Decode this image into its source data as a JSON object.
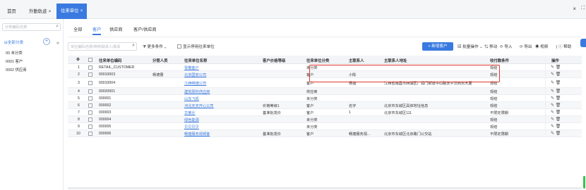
{
  "tabs": [
    {
      "label": "首页",
      "closable": false
    },
    {
      "label": "外勤轨迹",
      "closable": true
    },
    {
      "label": "往来单位",
      "closable": true
    }
  ],
  "left_panel": {
    "search_placeholder": "分类编码/名称",
    "all_label": "全部分类",
    "items": [
      "00 未分类",
      "0001 客户",
      "0002 供应商"
    ]
  },
  "subtabs": [
    "全部",
    "客户",
    "供应商",
    "客户/供应商"
  ],
  "active_subtab": 1,
  "toolbar": {
    "search_placeholder": "单位编码/名称/简称/联系人/联系",
    "more_conditions": "更多条件",
    "show_disabled": "显示停用往来单位",
    "new_button": "+ 新增客户",
    "actions": [
      "批量操作",
      "移动",
      "导入",
      "导出",
      "视频",
      "帮助"
    ]
  },
  "table": {
    "headers": [
      "序号",
      "往来单位编码",
      "分管人员",
      "往来单位名称",
      "客户价格等级",
      "往来单位分类",
      "主联系人",
      "主联系人地址",
      "收付款条件",
      "操作"
    ],
    "rows": [
      {
        "no": "1",
        "code": "RETAIL_CUSTOMER",
        "manager": "",
        "name": "零散客户",
        "price_level": "",
        "category": "未分类",
        "contact": "",
        "address": "",
        "payment": "现结"
      },
      {
        "no": "2",
        "code": "00010003",
        "manager": "杨德惠",
        "name": "北京国安公司",
        "price_level": "",
        "category": "客户",
        "contact": "小陈",
        "address": "",
        "payment": "现结"
      },
      {
        "no": "3",
        "code": "00010004",
        "manager": "",
        "name": "江西畅捷公司",
        "price_level": "",
        "category": "客户",
        "contact": "杨捷",
        "address": "江西省南昌市西湖区广润门街道中山路太平洋商务大厦",
        "payment": "现结"
      },
      {
        "no": "4",
        "code": "00020001",
        "manager": "",
        "name": "建筑原料供应商",
        "price_level": "",
        "category": "供应商",
        "contact": "",
        "address": "",
        "payment": "现结"
      },
      {
        "no": "5",
        "code": "000001",
        "manager": "",
        "name": "山东飞机",
        "price_level": "",
        "category": "未分类",
        "contact": "",
        "address": "",
        "payment": "现结"
      },
      {
        "no": "6",
        "code": "000002",
        "manager": "",
        "name": "河北天天开心公司",
        "price_level": "价格等级1",
        "category": "客户",
        "contact": "名字",
        "address": "北京市东城区具体地址信息",
        "payment": "现结"
      },
      {
        "no": "7",
        "code": "000003",
        "manager": "",
        "name": "华某计",
        "price_level": "基准批发价",
        "category": "客户",
        "contact": "1",
        "address": "北京市东城区111",
        "payment": "不限定限期"
      },
      {
        "no": "8",
        "code": "000004",
        "manager": "",
        "name": "绿色能源",
        "price_level": "",
        "category": "未分类",
        "contact": "",
        "address": "",
        "payment": "现结"
      },
      {
        "no": "9",
        "code": "000005",
        "manager": "",
        "name": "贝贝贝贝",
        "price_level": "",
        "category": "未分类",
        "contact": "",
        "address": "",
        "payment": "现结"
      },
      {
        "no": "10",
        "code": "000006",
        "manager": "",
        "name": "畅捷服务视频客",
        "price_level": "基准批发价",
        "category": "客户",
        "contact": "畅捷服务视...",
        "address": "北京市东城区北京路门公交站",
        "payment": "不限定限期"
      }
    ],
    "ops_icons": [
      "edit-icon",
      "delete-icon"
    ]
  },
  "colors": {
    "accent": "#3a7ae0",
    "highlight": "#e0382f"
  }
}
